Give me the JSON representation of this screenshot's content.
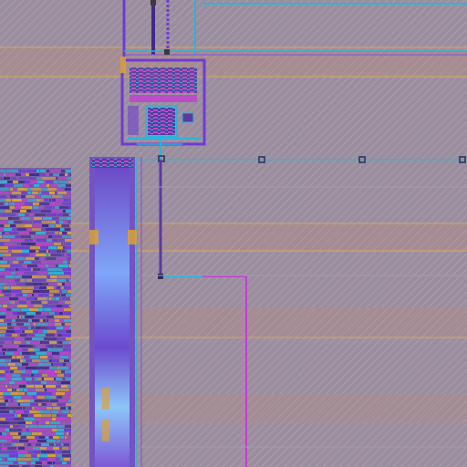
{
  "canvas": {
    "background": "#9a8e9e",
    "hatch_color": "#b7a7b8",
    "metal1": "#6f3bd6",
    "metal2": "#c03fd0",
    "via": "#2fb2d6",
    "power_stripe": "#b5837d",
    "diffusion": "#d8a23a",
    "glow": "#86c9ff"
  },
  "layers": [
    {
      "name": "metal1",
      "color": "#6f3bd6"
    },
    {
      "name": "metal2",
      "color": "#c03fd0"
    },
    {
      "name": "via",
      "color": "#2fb2d6"
    },
    {
      "name": "power-stripe",
      "color": "#b5837d"
    },
    {
      "name": "diffusion",
      "color": "#d8a23a"
    }
  ]
}
